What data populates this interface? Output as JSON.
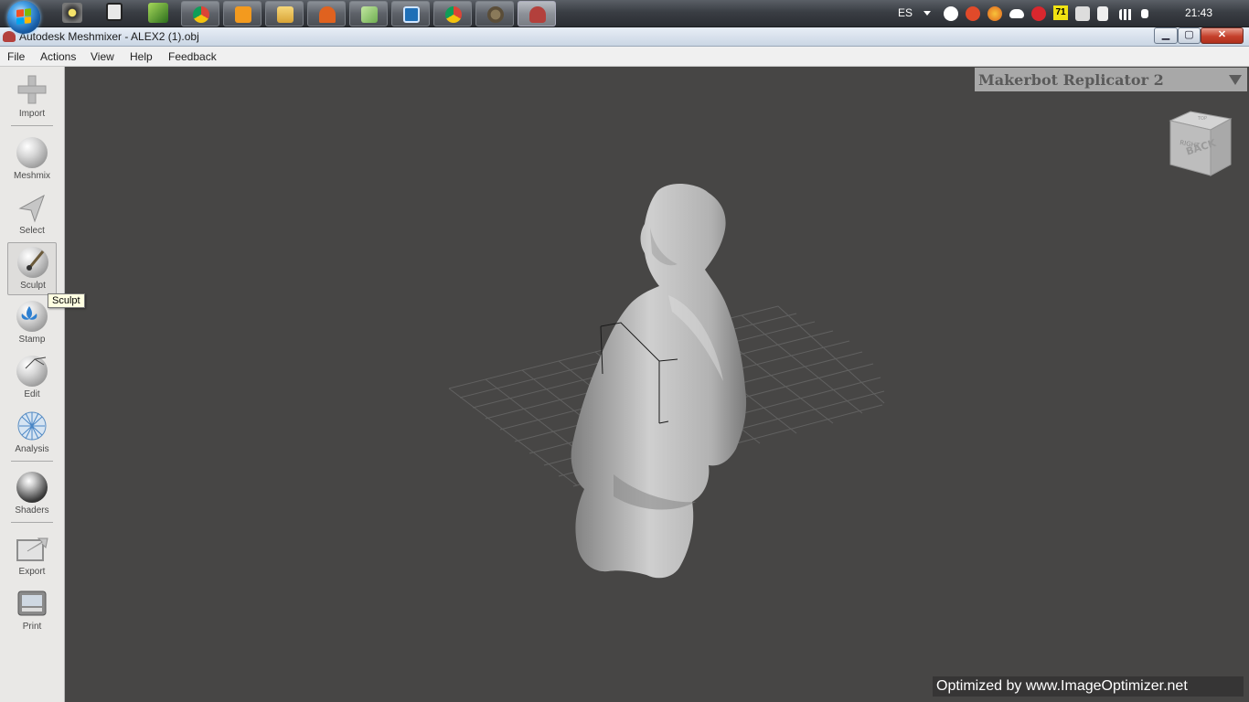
{
  "taskbar": {
    "language": "ES",
    "tray_badge": "71",
    "clock": "21:43",
    "pinned_icons": [
      "eye-app-icon",
      "calculator-icon",
      "notepad-plus-icon",
      "chrome-icon",
      "media-player-icon",
      "explorer-icon",
      "app-orange-icon",
      "app-green-icon",
      "app-blue-icon",
      "chrome-icon",
      "gimp-icon",
      "meshmixer-icon"
    ]
  },
  "window": {
    "title": "Autodesk Meshmixer - ALEX2 (1).obj",
    "minimize": "▁",
    "maximize": "▢",
    "close": "✕"
  },
  "menu": {
    "file": "File",
    "actions": "Actions",
    "view": "View",
    "help": "Help",
    "feedback": "Feedback"
  },
  "tools": {
    "import": "Import",
    "meshmix": "Meshmix",
    "select": "Select",
    "sculpt": "Sculpt",
    "stamp": "Stamp",
    "edit": "Edit",
    "analysis": "Analysis",
    "shaders": "Shaders",
    "export": "Export",
    "print": "Print"
  },
  "tooltip": "Sculpt",
  "printer": {
    "name": "Makerbot Replicator 2"
  },
  "view_cube": {
    "face_label": "BACK",
    "side_label": "RIGHT",
    "top_label": "TOP"
  },
  "watermark": "Optimized by www.ImageOptimizer.net",
  "colors": {
    "viewport_bg": "#474645",
    "model": "#b9b9b9",
    "toolbar_bg": "#e9e8e6",
    "printer_panel": "#a8a8a8"
  }
}
